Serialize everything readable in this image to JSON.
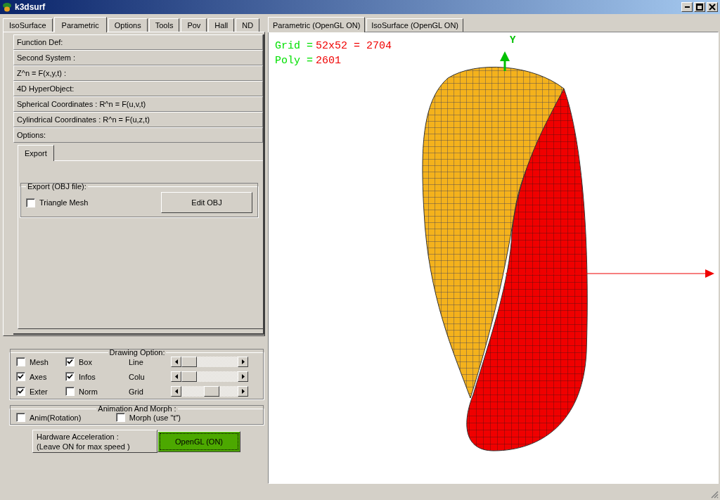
{
  "window": {
    "title": "k3dsurf"
  },
  "left_tabs": [
    {
      "label": "IsoSurface",
      "selected": false
    },
    {
      "label": "Parametric",
      "selected": true
    },
    {
      "label": "Options",
      "selected": false
    },
    {
      "label": "Tools",
      "selected": false
    },
    {
      "label": "Pov",
      "selected": false
    },
    {
      "label": "Hall",
      "selected": false
    },
    {
      "label": "ND",
      "selected": false
    }
  ],
  "sections": [
    {
      "label": "Function Def:"
    },
    {
      "label": "Second System :"
    },
    {
      "label": "Z^n = F(x,y,t) :"
    },
    {
      "label": "4D HyperObject:"
    },
    {
      "label": "Spherical Coordinates : R^n = F(u,v,t)"
    },
    {
      "label": "Cylindrical Coordinates : R^n = F(u,z,t)"
    },
    {
      "label": "Options:"
    }
  ],
  "options_panel": {
    "tabs": [
      {
        "label": "Export",
        "selected": true
      }
    ],
    "group": {
      "title": "Export (OBJ file):",
      "checkbox": {
        "label": "Triangle Mesh",
        "checked": false
      },
      "button": "Edit OBJ"
    }
  },
  "drawing_option": {
    "title": "Drawing Option:",
    "checkboxes": [
      {
        "label": "Mesh",
        "checked": false
      },
      {
        "label": "Box",
        "checked": true
      },
      {
        "label": "Axes",
        "checked": true
      },
      {
        "label": "Infos",
        "checked": true
      },
      {
        "label": "Exter",
        "checked": true
      },
      {
        "label": "Norm",
        "checked": false
      }
    ],
    "sliders": [
      {
        "label": "Line",
        "level": 0
      },
      {
        "label": "Colu",
        "level": 0
      },
      {
        "label": "Grid",
        "level": 0.55
      }
    ]
  },
  "animation": {
    "title": "Animation And Morph :",
    "checkboxes": [
      {
        "label": "Anim(Rotation)",
        "checked": false
      },
      {
        "label": "Morph (use \"t\")",
        "checked": false
      }
    ]
  },
  "hardware": {
    "label": [
      "Hardware Acceleration :",
      "(Leave ON for max speed )"
    ],
    "button": {
      "label": "OpenGL (ON)",
      "on": true
    }
  },
  "view_tabs": [
    {
      "label": "Parametric (OpenGL ON)",
      "selected": true
    },
    {
      "label": "IsoSurface (OpenGL ON)",
      "selected": false
    }
  ],
  "viewport": {
    "info": [
      {
        "label": "Grid =",
        "value": "52x52 = 2704"
      },
      {
        "label": "Poly =",
        "value": "2601"
      }
    ],
    "axis_label": "Y"
  }
}
